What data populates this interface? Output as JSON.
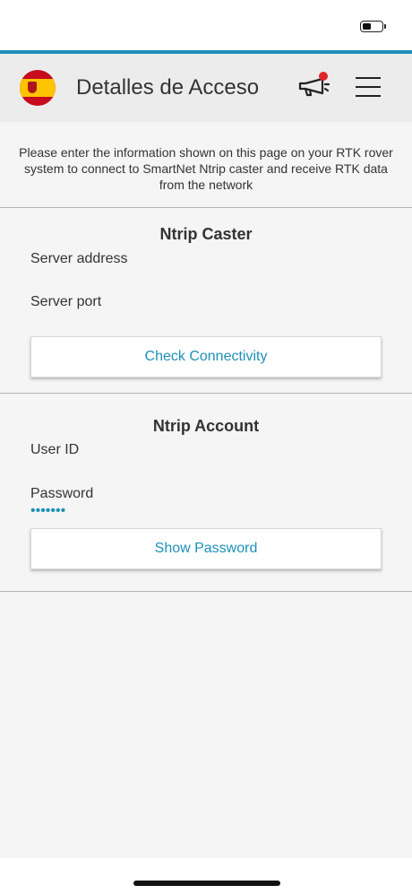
{
  "header": {
    "title": "Detalles de Acceso"
  },
  "intro_text": "Please enter the information shown on this page on your RTK rover system to connect to SmartNet Ntrip caster and receive RTK data from the network",
  "caster": {
    "title": "Ntrip Caster",
    "server_address_label": "Server address",
    "server_port_label": "Server port",
    "check_button": "Check Connectivity"
  },
  "account": {
    "title": "Ntrip Account",
    "user_id_label": "User ID",
    "password_label": "Password",
    "password_mask": "•••••••",
    "show_button": "Show Password"
  },
  "colors": {
    "accent": "#1d90b8",
    "notification": "#e0262b",
    "header_bg": "#ececec"
  },
  "icons": {
    "flag": "spain-flag-icon",
    "megaphone": "megaphone-icon",
    "menu": "hamburger-menu-icon",
    "battery": "battery-icon"
  }
}
